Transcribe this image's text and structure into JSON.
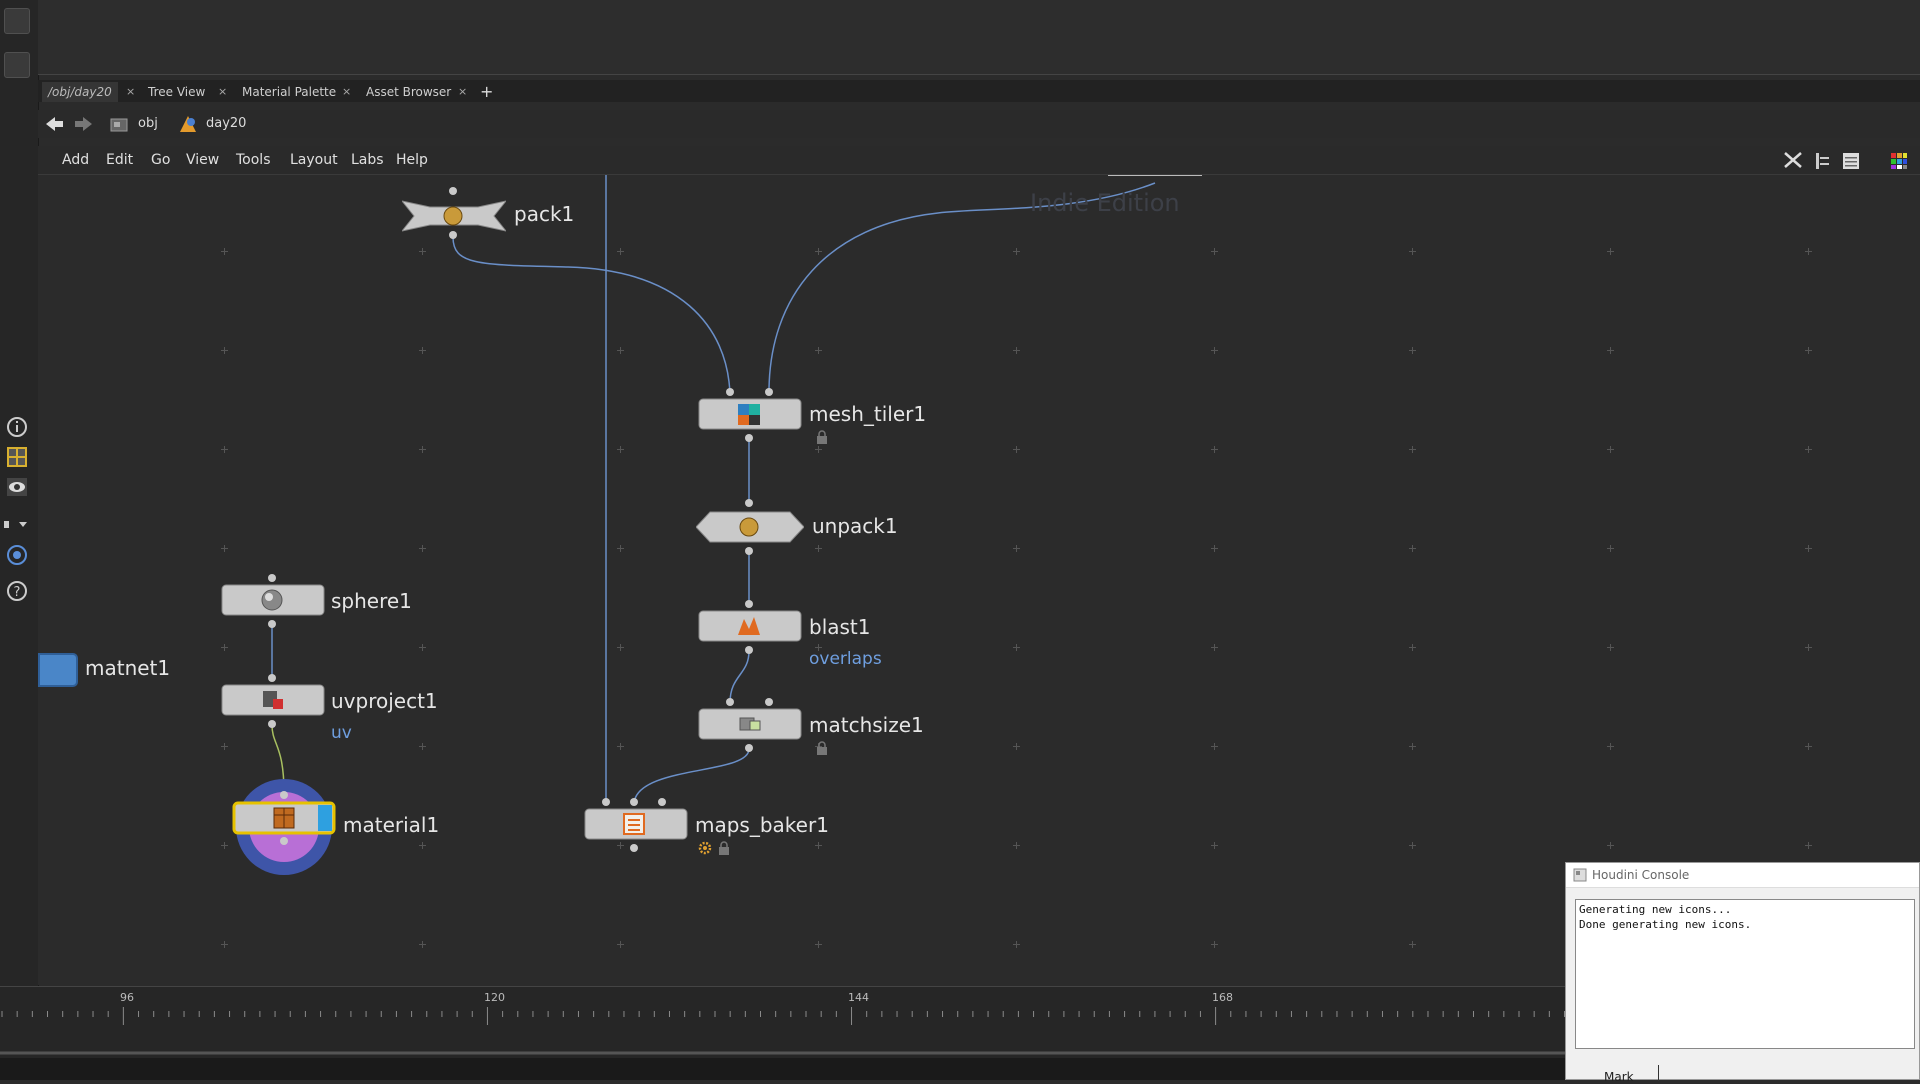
{
  "tabs": [
    {
      "label": "/obj/day20",
      "active": true
    },
    {
      "label": "Tree View",
      "active": false
    },
    {
      "label": "Material Palette",
      "active": false
    },
    {
      "label": "Asset Browser",
      "active": false
    }
  ],
  "tab_close_glyph": "×",
  "tab_add_glyph": "+",
  "path": {
    "root": "obj",
    "current": "day20"
  },
  "menu": [
    "Add",
    "Edit",
    "Go",
    "View",
    "Tools",
    "Layout",
    "Labs",
    "Help"
  ],
  "watermark": "Indie Edition",
  "nodes": {
    "pack": {
      "name": "pack1"
    },
    "mesh_tiler": {
      "name": "mesh_tiler1"
    },
    "unpack": {
      "name": "unpack1"
    },
    "blast": {
      "name": "blast1",
      "group": "overlaps"
    },
    "matchsize": {
      "name": "matchsize1"
    },
    "sphere": {
      "name": "sphere1"
    },
    "uvproject": {
      "name": "uvproject1",
      "attr": "uv"
    },
    "material": {
      "name": "material1"
    },
    "maps_baker": {
      "name": "maps_baker1"
    },
    "matnet": {
      "name": "matnet1"
    }
  },
  "timeline": {
    "ticks": [
      "96",
      "120",
      "144",
      "168"
    ]
  },
  "console": {
    "title": "Houdini Console",
    "lines": [
      "Generating new icons...",
      "Done generating new icons."
    ],
    "button": "Mark"
  },
  "colors": {
    "wire": "#6a8fc8",
    "node_body": "#c9c9c9",
    "selected": "#e6c200",
    "material_ring_outer": "#3e55a8",
    "material_ring_inner": "#b86fd6",
    "matnet": "#4a86c8"
  }
}
